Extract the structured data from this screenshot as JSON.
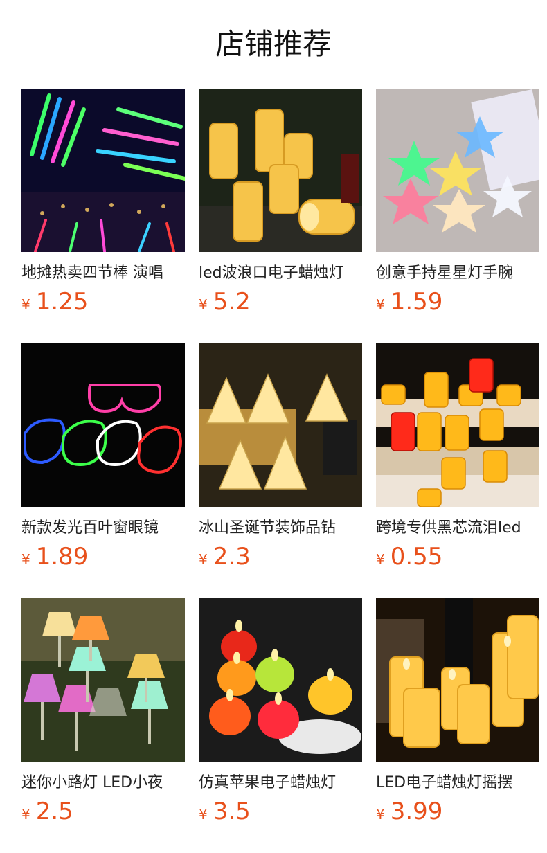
{
  "header": {
    "title": "店铺推荐"
  },
  "products": [
    {
      "name": "地摊热卖四节棒 演唱",
      "currency": "¥",
      "price": "1.25",
      "image_icon": "glow-sticks-image"
    },
    {
      "name": "led波浪口电子蜡烛灯",
      "currency": "¥",
      "price": "5.2",
      "image_icon": "led-candles-image"
    },
    {
      "name": "创意手持星星灯手腕",
      "currency": "¥",
      "price": "1.59",
      "image_icon": "star-lights-image"
    },
    {
      "name": "新款发光百叶窗眼镜",
      "currency": "¥",
      "price": "1.89",
      "image_icon": "glowing-glasses-image"
    },
    {
      "name": "冰山圣诞节装饰品钻",
      "currency": "¥",
      "price": "2.3",
      "image_icon": "crystal-tree-lights-image"
    },
    {
      "name": "跨境专供黑芯流泪led",
      "currency": "¥",
      "price": "0.55",
      "image_icon": "tealight-candles-image"
    },
    {
      "name": "迷你小路灯 LED小夜",
      "currency": "¥",
      "price": "2.5",
      "image_icon": "mini-lamps-image"
    },
    {
      "name": "仿真苹果电子蜡烛灯",
      "currency": "¥",
      "price": "3.5",
      "image_icon": "apple-candles-image"
    },
    {
      "name": "LED电子蜡烛灯摇摆",
      "currency": "¥",
      "price": "3.99",
      "image_icon": "swing-candles-image"
    }
  ]
}
